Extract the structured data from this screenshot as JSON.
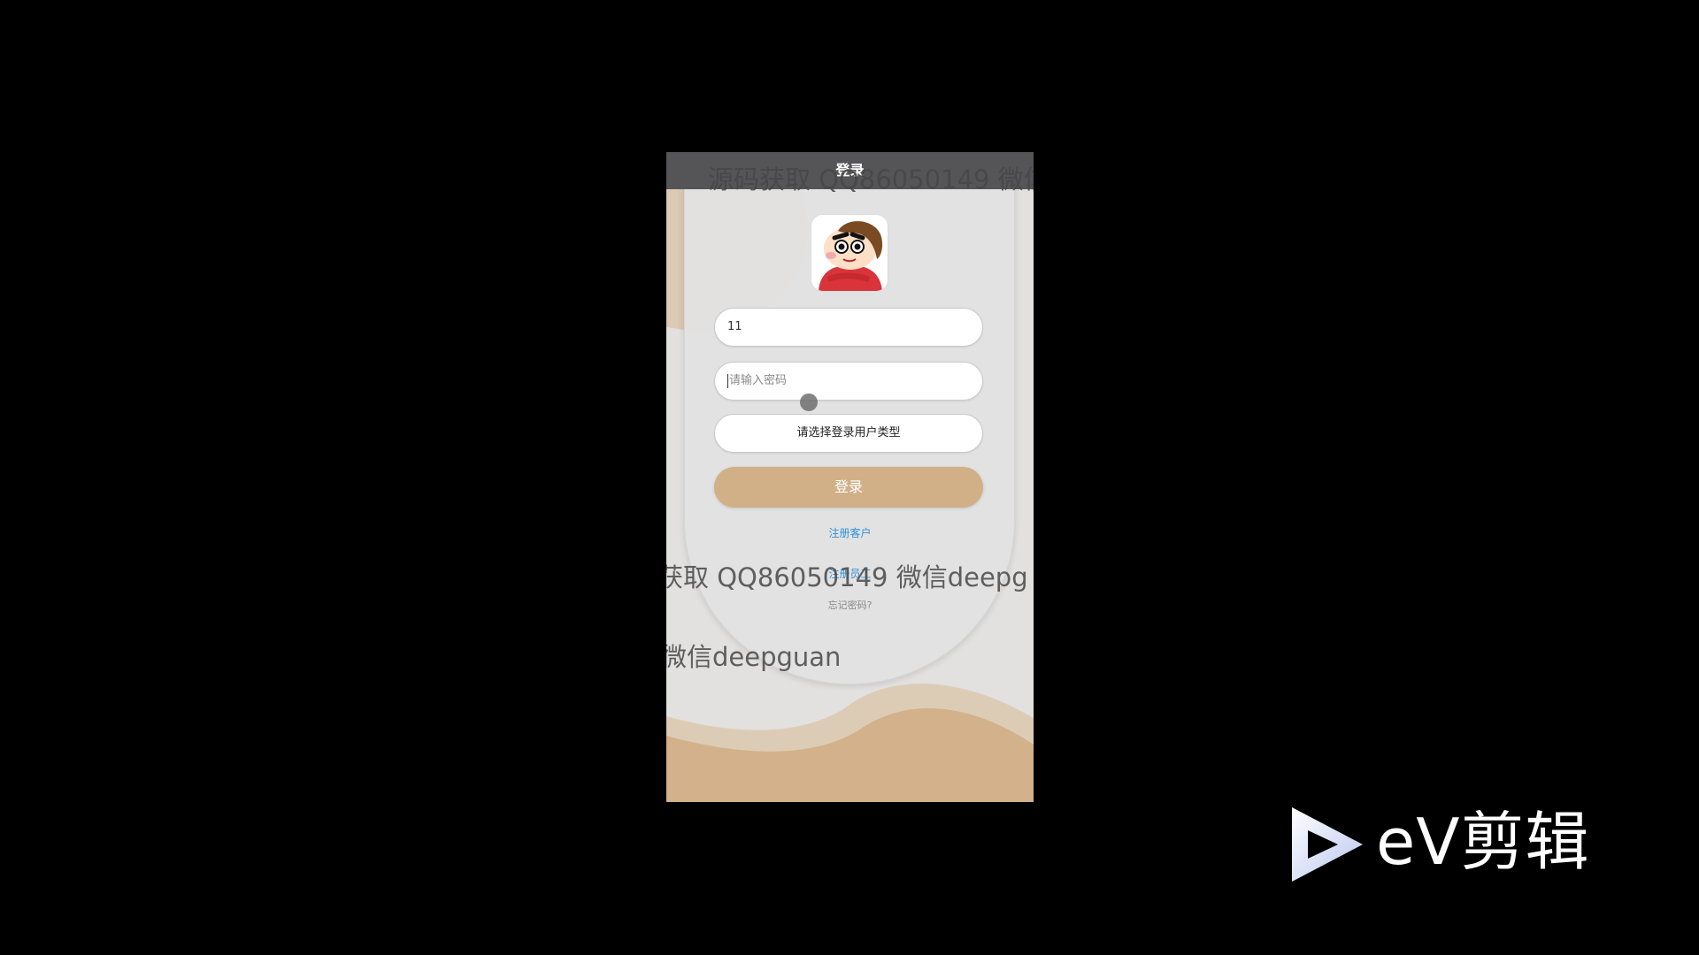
{
  "page": {
    "title": "登录"
  },
  "login": {
    "username_value": "11",
    "password_placeholder": "请输入密码",
    "user_type_label": "请选择登录用户类型",
    "login_button_label": "登录",
    "register_link": "注册客户",
    "admin_link": "注册员工",
    "forgot_link": "忘记密码?"
  },
  "watermark": {
    "line1": "源码获取 QQ86050149 微信",
    "line2": "获取 QQ86050149 微信deepg",
    "line3": "微信deepguan"
  },
  "video_editor": {
    "brand": "eV剪辑"
  },
  "colors": {
    "accent": "#d1b088",
    "top_bar": "#555557",
    "link": "#2f8fdc",
    "background": "#e2e1e0"
  }
}
